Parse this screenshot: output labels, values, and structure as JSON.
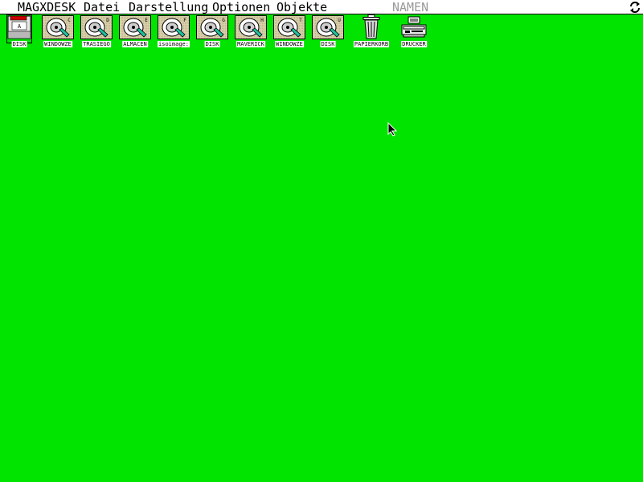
{
  "menubar": {
    "app": "MAGXDESK",
    "items": [
      "Datei",
      "Darstellung",
      "Optionen",
      "Objekte"
    ],
    "disabled_item": "NAMEN"
  },
  "desktop": {
    "background_color": "#00e400",
    "icons": [
      {
        "type": "floppy",
        "letter": "A",
        "label": "DISK"
      },
      {
        "type": "harddisk",
        "letter": "C",
        "label": "WINDOWZE"
      },
      {
        "type": "harddisk",
        "letter": "D",
        "label": "TRASIEGO"
      },
      {
        "type": "harddisk",
        "letter": "E",
        "label": "ALMACEN"
      },
      {
        "type": "harddisk",
        "letter": "F",
        "label": "isoimage:"
      },
      {
        "type": "harddisk",
        "letter": "G",
        "label": "DISK"
      },
      {
        "type": "harddisk",
        "letter": "H",
        "label": "MAVERICK"
      },
      {
        "type": "harddisk",
        "letter": "T",
        "label": "WINDOWZE"
      },
      {
        "type": "harddisk",
        "letter": "U",
        "label": "DISK"
      },
      {
        "type": "trash",
        "letter": "",
        "label": "PAPIERKORB"
      },
      {
        "type": "printer",
        "letter": "",
        "label": "DRUCKER"
      }
    ]
  }
}
